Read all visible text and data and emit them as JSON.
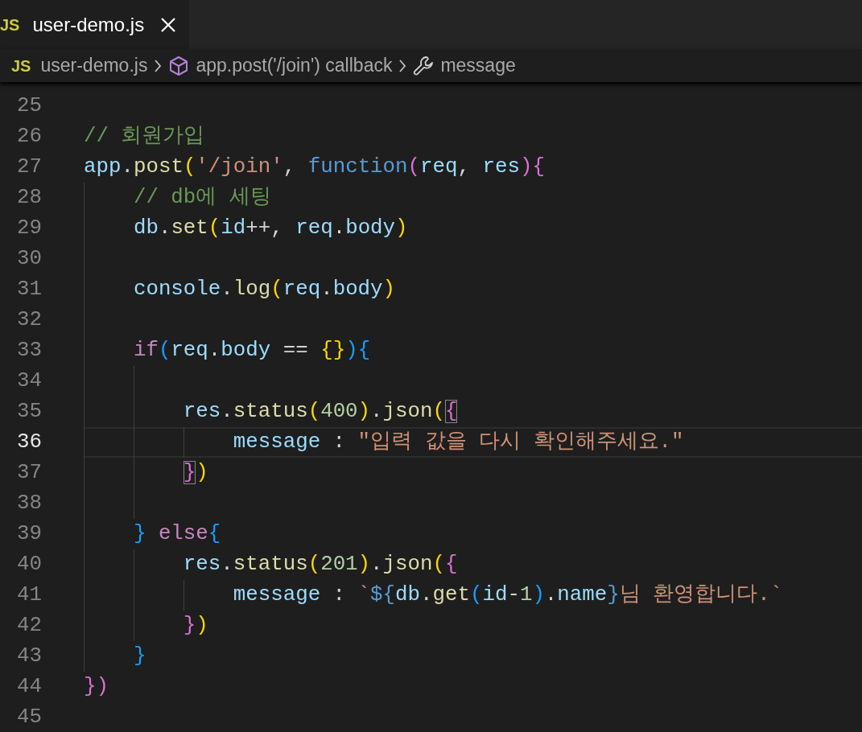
{
  "tab": {
    "icon_label": "JS",
    "title": "user-demo.js",
    "selected": true
  },
  "breadcrumb": [
    {
      "kind": "file",
      "icon_label": "JS",
      "label": "user-demo.js"
    },
    {
      "kind": "module",
      "label": "app.post('/join') callback"
    },
    {
      "kind": "property",
      "label": "message"
    }
  ],
  "lines": [
    {
      "number": "25",
      "current": false
    },
    {
      "number": "26",
      "current": false,
      "tokens": [
        {
          "kind": "cmt",
          "text": "// 회원가입"
        }
      ]
    },
    {
      "number": "27",
      "current": false,
      "tokens": [
        {
          "kind": "var",
          "text": "app"
        },
        {
          "kind": "plain",
          "text": "."
        },
        {
          "kind": "fn",
          "text": "post"
        },
        {
          "kind": "b1",
          "text": "("
        },
        {
          "kind": "str",
          "text": "'/join'"
        },
        {
          "kind": "plain",
          "text": ", "
        },
        {
          "kind": "kw",
          "text": "function"
        },
        {
          "kind": "b2",
          "text": "("
        },
        {
          "kind": "var",
          "text": "req"
        },
        {
          "kind": "plain",
          "text": ", "
        },
        {
          "kind": "var",
          "text": "res"
        },
        {
          "kind": "b2",
          "text": "){"
        }
      ]
    },
    {
      "number": "28",
      "current": false,
      "tokens": [
        {
          "kind": "indent"
        },
        {
          "kind": "cmt",
          "text": "// db에 세팅"
        }
      ]
    },
    {
      "number": "29",
      "current": false,
      "tokens": [
        {
          "kind": "indent"
        },
        {
          "kind": "var",
          "text": "db"
        },
        {
          "kind": "plain",
          "text": "."
        },
        {
          "kind": "fn",
          "text": "set"
        },
        {
          "kind": "b1",
          "text": "("
        },
        {
          "kind": "var",
          "text": "id"
        },
        {
          "kind": "plain",
          "text": "++, "
        },
        {
          "kind": "var",
          "text": "req"
        },
        {
          "kind": "plain",
          "text": "."
        },
        {
          "kind": "var",
          "text": "body"
        },
        {
          "kind": "b1",
          "text": ")"
        }
      ]
    },
    {
      "number": "30",
      "current": false,
      "tokens": [
        {
          "kind": "indent"
        }
      ]
    },
    {
      "number": "31",
      "current": false,
      "tokens": [
        {
          "kind": "indent"
        },
        {
          "kind": "var",
          "text": "console"
        },
        {
          "kind": "plain",
          "text": "."
        },
        {
          "kind": "fn",
          "text": "log"
        },
        {
          "kind": "b1",
          "text": "("
        },
        {
          "kind": "var",
          "text": "req"
        },
        {
          "kind": "plain",
          "text": "."
        },
        {
          "kind": "var",
          "text": "body"
        },
        {
          "kind": "b1",
          "text": ")"
        }
      ]
    },
    {
      "number": "32",
      "current": false,
      "tokens": [
        {
          "kind": "indent"
        }
      ]
    },
    {
      "number": "33",
      "current": false,
      "tokens": [
        {
          "kind": "indent"
        },
        {
          "kind": "ctl",
          "text": "if"
        },
        {
          "kind": "b3",
          "text": "("
        },
        {
          "kind": "var",
          "text": "req"
        },
        {
          "kind": "plain",
          "text": "."
        },
        {
          "kind": "var",
          "text": "body"
        },
        {
          "kind": "plain",
          "text": " == "
        },
        {
          "kind": "b1",
          "text": "{}"
        },
        {
          "kind": "b3",
          "text": "){"
        }
      ]
    },
    {
      "number": "34",
      "current": false,
      "tokens": [
        {
          "kind": "indent"
        },
        {
          "kind": "indent"
        }
      ]
    },
    {
      "number": "35",
      "current": false,
      "tokens": [
        {
          "kind": "indent"
        },
        {
          "kind": "indent"
        },
        {
          "kind": "var",
          "text": "res"
        },
        {
          "kind": "plain",
          "text": "."
        },
        {
          "kind": "fn",
          "text": "status"
        },
        {
          "kind": "b1",
          "text": "("
        },
        {
          "kind": "num",
          "text": "400"
        },
        {
          "kind": "b1",
          "text": ")"
        },
        {
          "kind": "plain",
          "text": "."
        },
        {
          "kind": "fn",
          "text": "json"
        },
        {
          "kind": "b1",
          "text": "("
        },
        {
          "kind": "b2",
          "text": "{",
          "matched": true
        }
      ]
    },
    {
      "number": "36",
      "current": true,
      "tokens": [
        {
          "kind": "indent"
        },
        {
          "kind": "indent"
        },
        {
          "kind": "indent"
        },
        {
          "kind": "var",
          "text": "message"
        },
        {
          "kind": "plain",
          "text": " : "
        },
        {
          "kind": "str",
          "text": "\"입력 값을 다시 확인해주세요.\""
        }
      ]
    },
    {
      "number": "37",
      "current": false,
      "tokens": [
        {
          "kind": "indent"
        },
        {
          "kind": "indent"
        },
        {
          "kind": "b2",
          "text": "}",
          "matched": true
        },
        {
          "kind": "b1",
          "text": ")"
        }
      ]
    },
    {
      "number": "38",
      "current": false,
      "tokens": [
        {
          "kind": "indent"
        },
        {
          "kind": "indent"
        }
      ]
    },
    {
      "number": "39",
      "current": false,
      "tokens": [
        {
          "kind": "indent"
        },
        {
          "kind": "b3",
          "text": "} "
        },
        {
          "kind": "ctl",
          "text": "else"
        },
        {
          "kind": "b3",
          "text": "{"
        }
      ]
    },
    {
      "number": "40",
      "current": false,
      "tokens": [
        {
          "kind": "indent"
        },
        {
          "kind": "indent"
        },
        {
          "kind": "var",
          "text": "res"
        },
        {
          "kind": "plain",
          "text": "."
        },
        {
          "kind": "fn",
          "text": "status"
        },
        {
          "kind": "b1",
          "text": "("
        },
        {
          "kind": "num",
          "text": "201"
        },
        {
          "kind": "b1",
          "text": ")"
        },
        {
          "kind": "plain",
          "text": "."
        },
        {
          "kind": "fn",
          "text": "json"
        },
        {
          "kind": "b1",
          "text": "("
        },
        {
          "kind": "b2",
          "text": "{"
        }
      ]
    },
    {
      "number": "41",
      "current": false,
      "tokens": [
        {
          "kind": "indent"
        },
        {
          "kind": "indent"
        },
        {
          "kind": "indent"
        },
        {
          "kind": "var",
          "text": "message"
        },
        {
          "kind": "plain",
          "text": " : "
        },
        {
          "kind": "str",
          "text": "`"
        },
        {
          "kind": "tpl",
          "text": "${"
        },
        {
          "kind": "var",
          "text": "db"
        },
        {
          "kind": "plain",
          "text": "."
        },
        {
          "kind": "fn",
          "text": "get"
        },
        {
          "kind": "b3",
          "text": "("
        },
        {
          "kind": "var",
          "text": "id"
        },
        {
          "kind": "plain",
          "text": "-"
        },
        {
          "kind": "num",
          "text": "1"
        },
        {
          "kind": "b3",
          "text": ")"
        },
        {
          "kind": "plain",
          "text": "."
        },
        {
          "kind": "var",
          "text": "name"
        },
        {
          "kind": "tpl",
          "text": "}"
        },
        {
          "kind": "str",
          "text": "님 환영합니다.`"
        }
      ]
    },
    {
      "number": "42",
      "current": false,
      "tokens": [
        {
          "kind": "indent"
        },
        {
          "kind": "indent"
        },
        {
          "kind": "b2",
          "text": "}"
        },
        {
          "kind": "b1",
          "text": ")"
        }
      ]
    },
    {
      "number": "43",
      "current": false,
      "tokens": [
        {
          "kind": "indent"
        },
        {
          "kind": "b3",
          "text": "}"
        }
      ]
    },
    {
      "number": "44",
      "current": false,
      "tokens": [
        {
          "kind": "b2",
          "text": "})"
        }
      ]
    },
    {
      "number": "45",
      "current": false
    }
  ]
}
